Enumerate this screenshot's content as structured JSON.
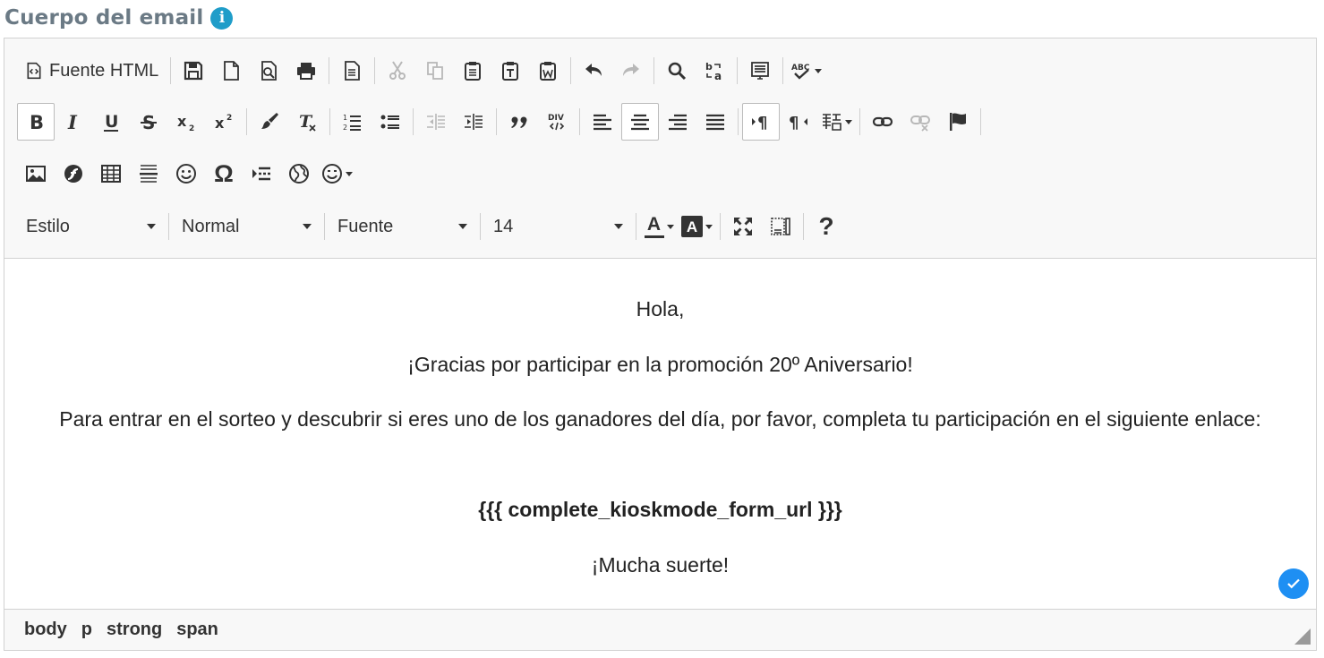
{
  "heading": {
    "title": "Cuerpo del email",
    "info_glyph": "i"
  },
  "toolbar": {
    "source_label": "Fuente HTML",
    "combos": {
      "style": "Estilo",
      "format": "Normal",
      "font": "Fuente",
      "size": "14"
    },
    "help_glyph": "?",
    "font_color_glyph": "A",
    "bg_color_glyph": "A",
    "special_char_glyph": "Ω"
  },
  "content": {
    "greeting": "Hola,",
    "thanks": "¡Gracias por participar en la promoción 20º Aniversario!",
    "instruction": "Para entrar en el sorteo y descubrir si eres uno de los ganadores del día, por favor, completa tu participación en el siguiente enlace:",
    "placeholder_url": "{{{ complete_kioskmode_form_url }}}",
    "closing": "¡Mucha suerte!"
  },
  "statusbar": {
    "path": [
      "body",
      "p",
      "strong",
      "span"
    ]
  },
  "colors": {
    "accent": "#1f9dc9",
    "check_badge": "#1e8ff3",
    "heading_text": "#6b7a85"
  }
}
